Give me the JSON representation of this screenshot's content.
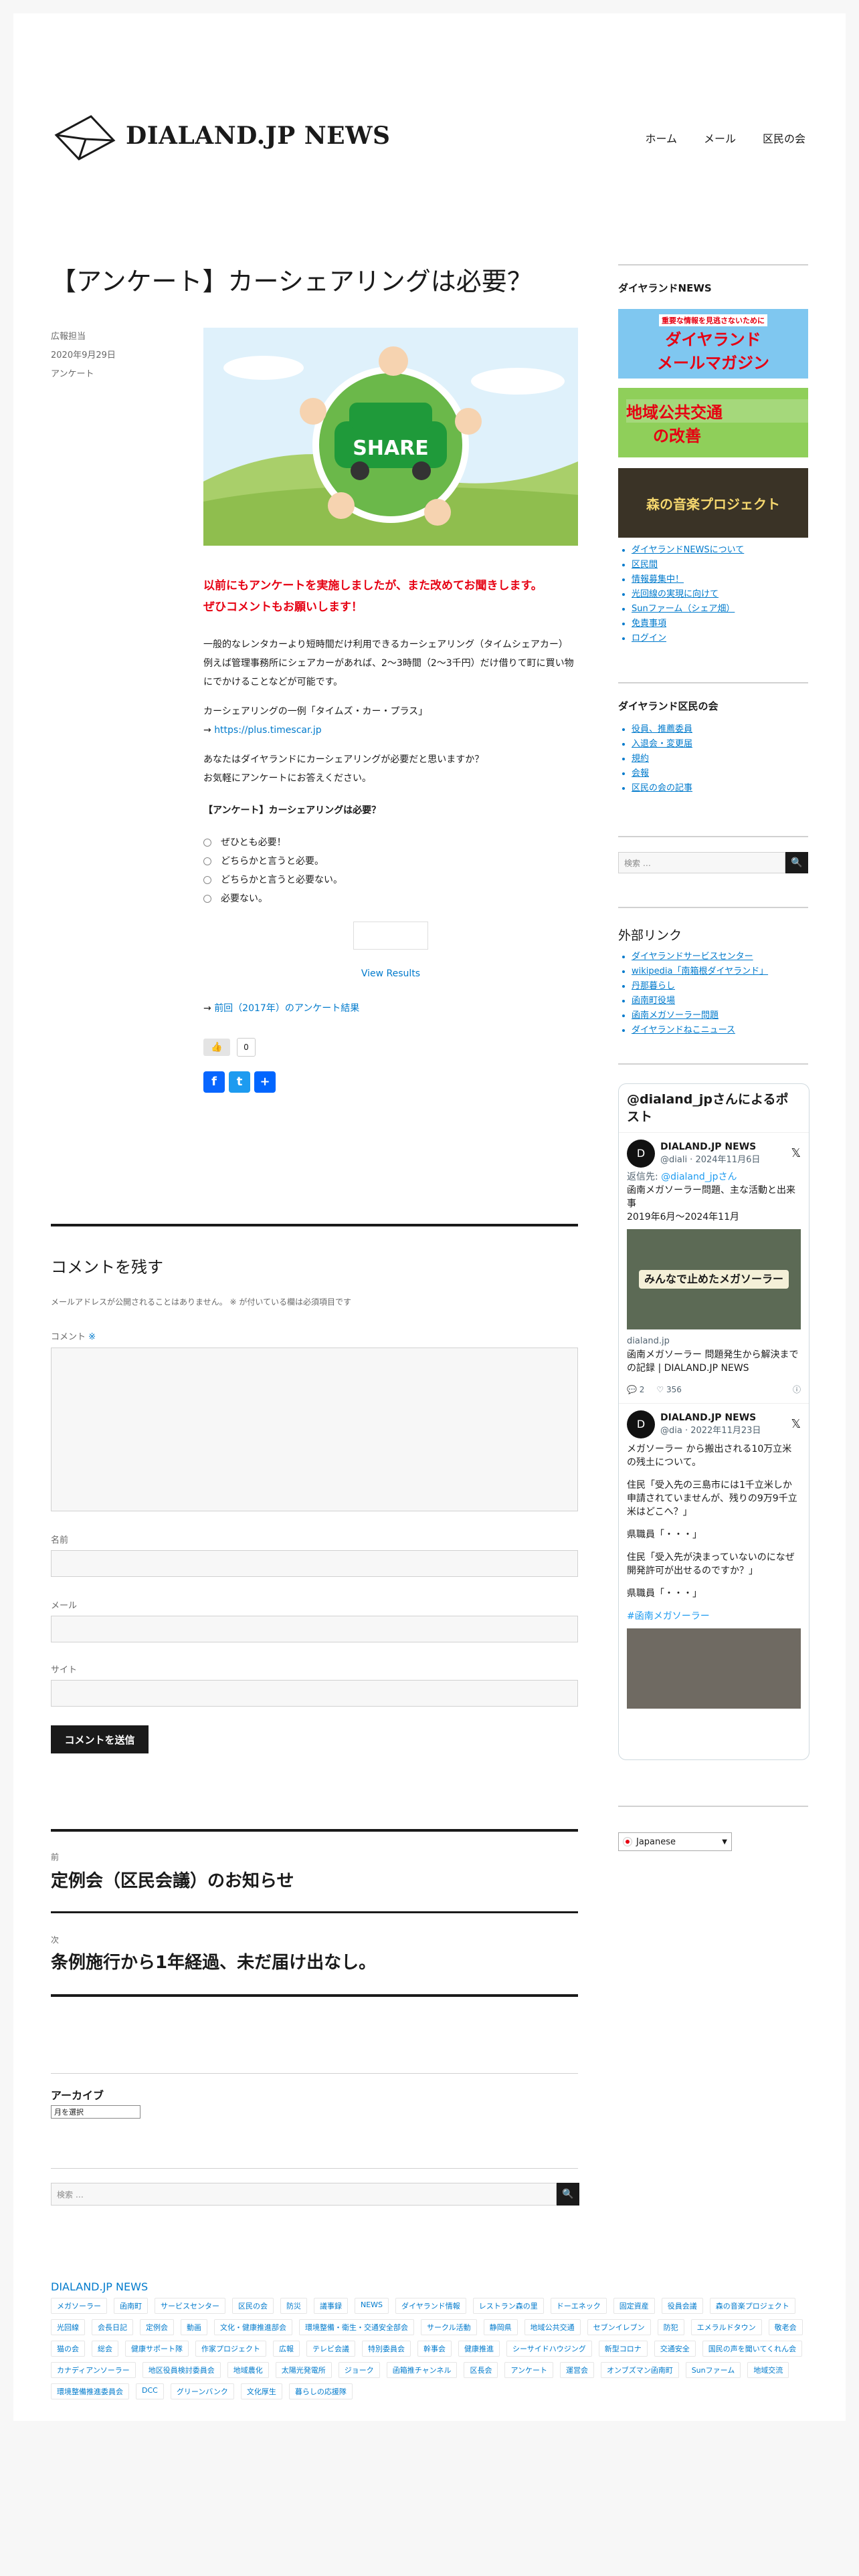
{
  "site": {
    "title": "DIALAND.JP NEWS"
  },
  "nav": [
    "ホーム",
    "メール",
    "区民の会"
  ],
  "post": {
    "title": "【アンケート】カーシェアリングは必要？",
    "author": "広報担当",
    "date": "2020年9月29日",
    "category": "アンケート",
    "image_text": "SHARE",
    "lead": [
      "以前にもアンケートを実施しましたが、また改めてお聞きします。",
      "ぜひコメントもお願いします！"
    ],
    "p1": [
      "一般的なレンタカーより短時間だけ利用できるカーシェアリング（タイムシェアカー）",
      "例えば管理事務所にシェアカーがあれば、2～3時間（2～3千円）だけ借りて町に買い物にでかけることなどが可能です。"
    ],
    "example_label": "カーシェアリングの一例「タイムズ・カー・プラス」",
    "example_arrow": "→",
    "example_link": "https://plus.timescar.jp",
    "p3": [
      "あなたはダイヤランドにカーシェアリングが必要だと思いますか？",
      "お気軽にアンケートにお答えください。"
    ],
    "poll": {
      "question": "【アンケート】カーシェアリングは必要？",
      "options": [
        "ぜひとも必要！",
        "どちらかと言うと必要。",
        "どちらかと言うと必要ない。",
        "必要ない。"
      ],
      "view_results": "View Results"
    },
    "prev_arrow": "→",
    "prev_results": "前回（2017年）のアンケート結果",
    "like_icon": "👍",
    "like_count": "0"
  },
  "comment": {
    "heading": "コメントを残す",
    "note": "メールアドレスが公開されることはありません。 ※ が付いている欄は必須項目です",
    "comment_label": "コメント",
    "required_mark": "※",
    "name_label": "名前",
    "email_label": "メール",
    "site_label": "サイト",
    "submit": "コメントを送信"
  },
  "post_nav": {
    "prev_label": "前",
    "prev_title": "定例会（区民会議）のお知らせ",
    "next_label": "次",
    "next_title": "条例施行から1年経過、未だ届け出なし。"
  },
  "archive": {
    "heading": "アーカイブ",
    "select": "月を選択"
  },
  "search": {
    "placeholder": "検索 …",
    "icon": "🔍"
  },
  "sidebar": {
    "news_heading": "ダイヤランドNEWS",
    "banner1": [
      "重要な情報を見逃さないために",
      "ダイヤランド",
      "メールマガジン"
    ],
    "banner2": [
      "地域公共交通",
      "の改善"
    ],
    "banner3": "森の音楽プロジェクト",
    "news_links": [
      "ダイヤランドNEWSについて",
      "区民間",
      "情報募集中！",
      "光回線の実現に向けて",
      "Sunファーム（シェア畑）",
      "免責事項",
      "ログイン"
    ],
    "kumin_heading": "ダイヤランド区民の会",
    "kumin_links": [
      "役員、推薦委員",
      "入退会・変更届",
      "規約",
      "会報",
      "区民の会の記事"
    ],
    "external_heading": "外部リンク",
    "external_links": [
      "ダイヤランドサービスセンター",
      "wikipedia「南箱根ダイヤランド」",
      "丹那暮らし",
      "函南町役場",
      "函南メガソーラー問題",
      "ダイヤランドねこニュース"
    ],
    "language": "Japanese"
  },
  "twitter": {
    "heading": "@dialand_jpさんによるポスト",
    "x_logo": "𝕏",
    "tweet1": {
      "name": "DIALAND.JP NEWS",
      "handle": "@diali · 2024年11月6日",
      "reply_prefix": "返信先:",
      "reply_handle": "@dialand_jpさん",
      "text": [
        "函南メガソーラー問題、主な活動と出来事",
        "2019年6月～2024年11月"
      ],
      "photo_text": "みんなで止めたメガソーラー",
      "card_domain": "dialand.jp",
      "card_title": "函南メガソーラー 問題発生から解決までの記録 | DIALAND.JP NEWS",
      "replies": "2",
      "likes": "356",
      "reply_icon": "💬",
      "like_icon": "♡",
      "info_icon": "ⓘ"
    },
    "tweet2": {
      "name": "DIALAND.JP NEWS",
      "handle": "@dia · 2022年11月23日",
      "text": [
        "メガソーラー から搬出される10万立米の残土について。",
        "住民「受入先の三島市には1千立米しか申請されていませんが、残りの9万9千立米はどこへ？」",
        "県職員「・・・」",
        "住民「受入先が決まっていないのになぜ開発許可が出せるのですか？」",
        "県職員「・・・」"
      ],
      "hashtag": "#函南メガソーラー"
    }
  },
  "footer": {
    "title": "DIALAND.JP NEWS",
    "tags": [
      "メガソーラー",
      "函南町",
      "サービスセンター",
      "区民の会",
      "防災",
      "議事録",
      "NEWS",
      "ダイヤランド情報",
      "レストラン森の里",
      "ドーエネック",
      "固定資産",
      "役員会議",
      "森の音楽プロジェクト",
      "光回線",
      "会長日記",
      "定例会",
      "動画",
      "文化・健康推進部会",
      "環境整備・衛生・交通安全部会",
      "サークル活動",
      "静岡県",
      "地域公共交通",
      "セブンイレブン",
      "防犯",
      "エメラルドタウン",
      "敬老会",
      "猫の会",
      "総会",
      "健康サポート隊",
      "作家プロジェクト",
      "広報",
      "テレビ会議",
      "特別委員会",
      "幹事会",
      "健康推進",
      "シーサイドハウジング",
      "新型コロナ",
      "交通安全",
      "国民の声を聞いてくれん会",
      "カナディアンソーラー",
      "地区役員検討委員会",
      "地域農化",
      "太陽光発電所",
      "ジョーク",
      "函箱推チャンネル",
      "区長会",
      "アンケート",
      "運営会",
      "オンブズマン函南町",
      "Sunファーム",
      "地域交流",
      "環境整備推進委員会",
      "DCC",
      "グリーンバンク",
      "文化厚生",
      "暮らしの応援隊"
    ]
  },
  "colors": {
    "accent": "#007acc",
    "dark": "#1a1a1a",
    "red": "#e60012"
  }
}
